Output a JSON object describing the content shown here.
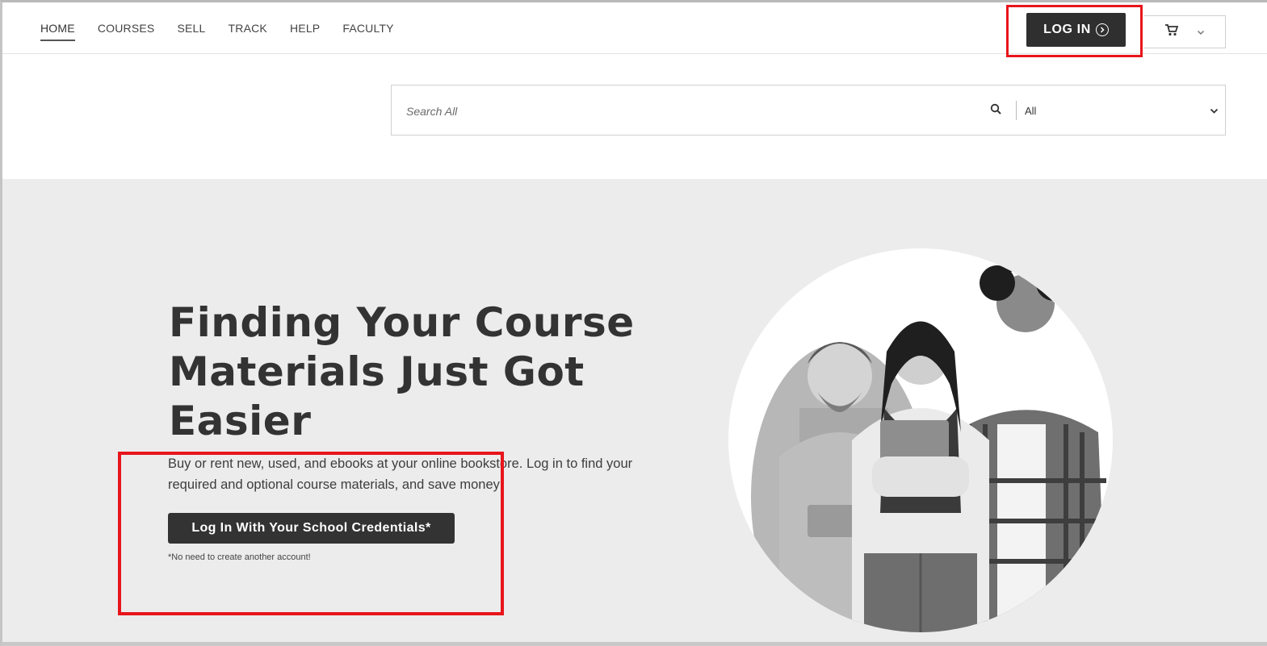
{
  "nav": {
    "items": [
      {
        "label": "HOME",
        "active": true
      },
      {
        "label": "COURSES"
      },
      {
        "label": "SELL"
      },
      {
        "label": "TRACK"
      },
      {
        "label": "HELP"
      },
      {
        "label": "FACULTY"
      }
    ]
  },
  "header": {
    "login_label": "LOG IN",
    "icons": [
      "arrow-right-circle-icon",
      "cart-icon",
      "chevron-down-icon"
    ]
  },
  "search": {
    "placeholder": "Search All",
    "category_selected": "All"
  },
  "hero": {
    "title": "Finding Your Course Materials Just Got Easier",
    "text": "Buy or rent new, used, and ebooks at your online bookstore. Log in to find your required and optional course materials, and save money!",
    "button_label": "Log In With Your School Credentials*",
    "note": "*No need to create another account!"
  },
  "colors": {
    "highlight": "#e8151b",
    "button_dark": "#2f2f2f",
    "hero_bg": "#ececec"
  }
}
